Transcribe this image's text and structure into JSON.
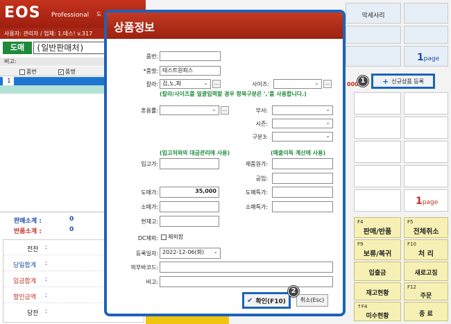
{
  "app": {
    "logo": "EOS",
    "edition": "Professional",
    "clipped_label": "도",
    "userline": "사용자: 관리자 / 업체: 1.테스! v.317"
  },
  "left": {
    "mode_button": "도매",
    "mode_input_value": "(일반판매처)",
    "memo_label": "비고:",
    "grid_headers": [
      "품번",
      "품명"
    ],
    "grid_row_number": "1",
    "sale_subtotal_label": "판매소계 :",
    "sale_subtotal_value": "0",
    "return_subtotal_label": "반품소계 :",
    "return_subtotal_value": "0",
    "totals": [
      "전잔",
      "당일합계",
      "입금합계",
      "할인금액",
      "당잔"
    ],
    "totals_colon": ":"
  },
  "right": {
    "top_cell": "악세사리",
    "page_top": "1",
    "page_bottom": "1",
    "page_suffix": "page",
    "new_product_button": "신규상품 등록",
    "red_fragment": "000",
    "fkeys": [
      {
        "key": "F4",
        "label": "판매/반품"
      },
      {
        "key": "F5",
        "label": "전체취소"
      },
      {
        "key": "F9",
        "label": "보류/복귀"
      },
      {
        "key": "F10",
        "label": "처  리"
      },
      {
        "key": "",
        "label": "입출금"
      },
      {
        "key": "",
        "label": "새로고침"
      },
      {
        "key": "",
        "label": "재고현황"
      },
      {
        "key": "F12",
        "label": "주문"
      },
      {
        "key": "↑F4",
        "label": "미수현황"
      },
      {
        "key": "",
        "label": "종  료"
      }
    ]
  },
  "markers": [
    "1",
    "2"
  ],
  "modal": {
    "title": "상품정보",
    "labels": {
      "item_no": "품번:",
      "item_name": "*품명:",
      "color": "칼라:",
      "size": "사이즈:",
      "mix": "혼용률:",
      "dept": "부서:",
      "season": "시즌:",
      "class3": "구분3:",
      "purchase_price": "입고가:",
      "cost": "제품원가:",
      "labor": "공임:",
      "wholesale": "도매가:",
      "wholesale_special": "도매특가:",
      "retail": "소매가:",
      "retail_special": "소매특가:",
      "stock": "현재고:",
      "dc_exclude": "DC제외:",
      "reg_date": "등록일자:",
      "ext_barcode": "외부바코드:",
      "memo": "비고:"
    },
    "values": {
      "item_name": "테스트원피스",
      "color": "검,노,파",
      "wholesale": "35,000",
      "reg_date": "2022-12-06(화)"
    },
    "notes": {
      "color_note": "(칼라/사이즈를 일괄입력할 경우 항목구분은 ','를 사용합니다.)",
      "purchase_note": "(입고처와의 대금관리에 사용)",
      "margin_note": "(매출이득 계산에 사용)"
    },
    "dc_exclude_option": "제외함",
    "dots": "...",
    "ok_button": "확인(F10)",
    "cancel_button": "취소(Esc)"
  }
}
